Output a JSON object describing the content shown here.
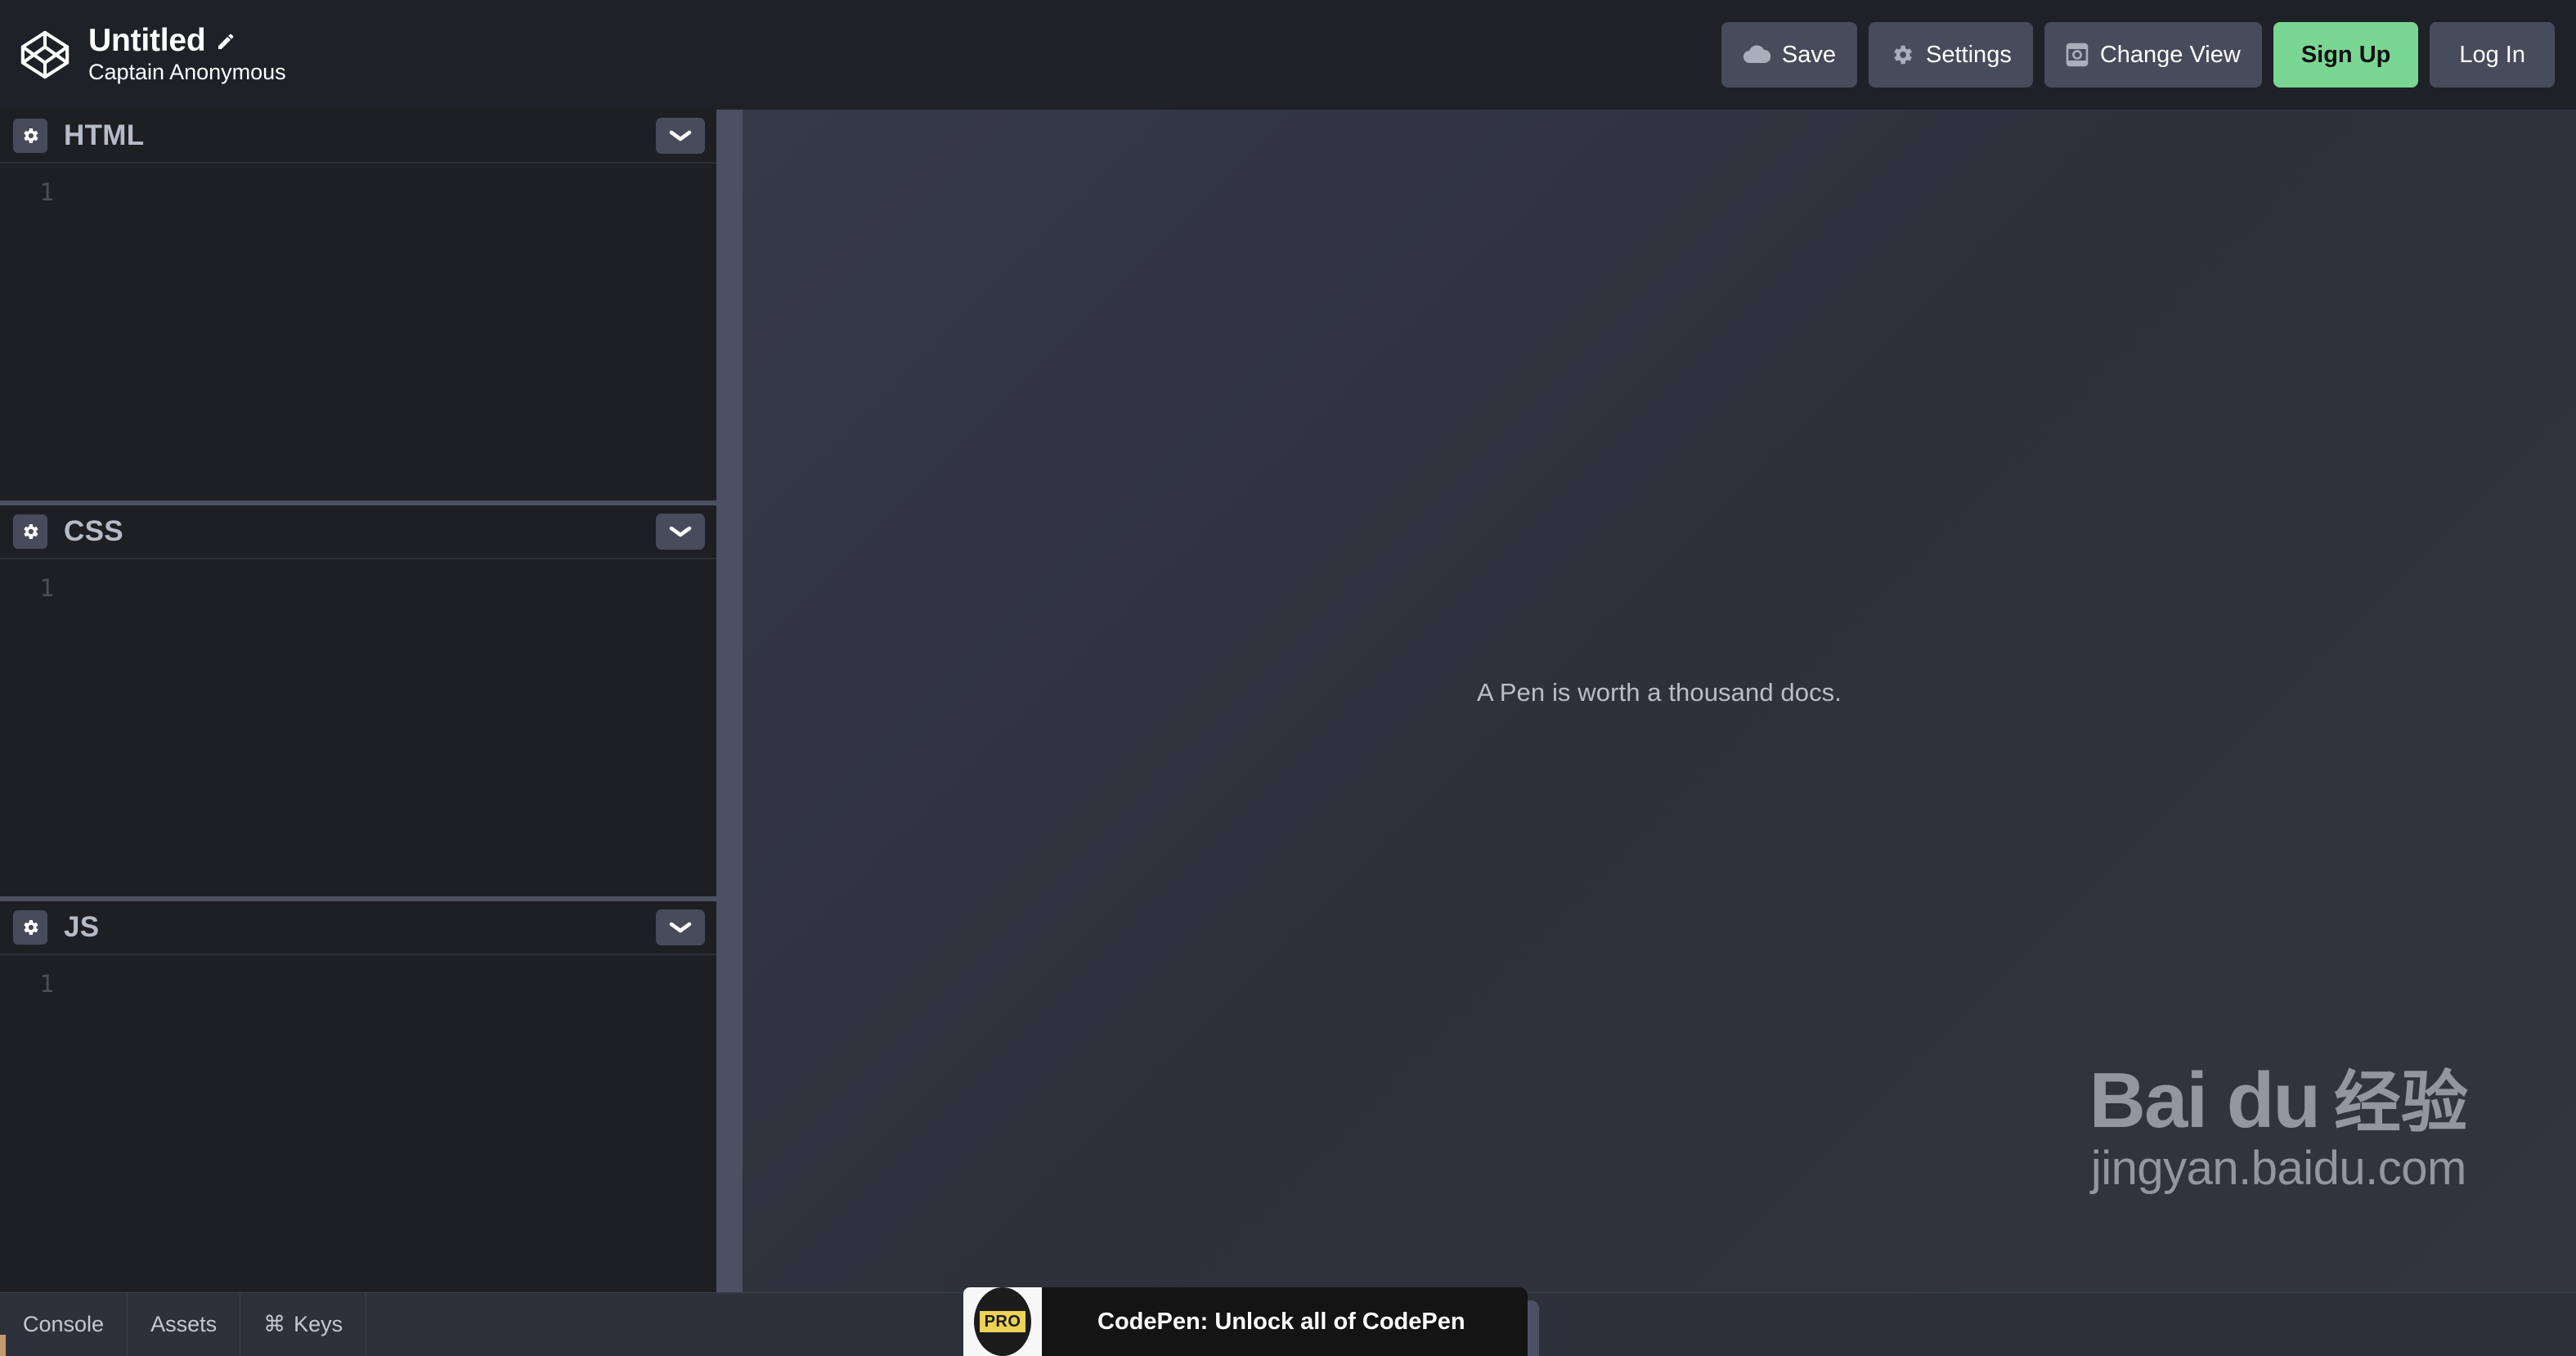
{
  "header": {
    "logo_icon": "codepen-logo-icon",
    "pen_title": "Untitled",
    "edit_icon": "pencil-edit-icon",
    "author": "Captain Anonymous",
    "actions": [
      {
        "label": "Save",
        "icon": "cloud-save-icon"
      },
      {
        "label": "Settings",
        "icon": "gear-icon"
      },
      {
        "label": "Change View",
        "icon": "change-view-icon"
      }
    ],
    "signup_label": "Sign Up",
    "login_label": "Log In",
    "signup_color": "#7ad693",
    "button_color": "#474c5c",
    "bar_color": "#1e2127"
  },
  "editors": [
    {
      "name": "html",
      "label": "HTML",
      "gear_icon": "gear-icon",
      "chevron_icon": "chevron-down-icon",
      "line_number": "1",
      "code": ""
    },
    {
      "name": "css",
      "label": "CSS",
      "gear_icon": "gear-icon",
      "chevron_icon": "chevron-down-icon",
      "line_number": "1",
      "code": ""
    },
    {
      "name": "js",
      "label": "JS",
      "gear_icon": "gear-icon",
      "chevron_icon": "chevron-down-icon",
      "line_number": "1",
      "code": ""
    }
  ],
  "preview": {
    "message": "A Pen is worth a thousand docs.",
    "background_start": "#353a48",
    "background_end": "#31353f"
  },
  "watermark": {
    "brand_latin": "Bai du",
    "brand_cn": "经验",
    "url": "jingyan.baidu.com",
    "paw_icon": "baidu-paw-icon"
  },
  "footer": {
    "tabs": [
      {
        "label": "Console",
        "icon": ""
      },
      {
        "label": "Assets",
        "icon": ""
      },
      {
        "label": "Keys",
        "icon": "⌘"
      }
    ]
  },
  "pro_banner": {
    "badge_text": "PRO",
    "message": "CodePen: Unlock all of CodePen",
    "close_icon": "close-icon",
    "badge_color": "#ecd257",
    "banner_color": "#141414"
  }
}
